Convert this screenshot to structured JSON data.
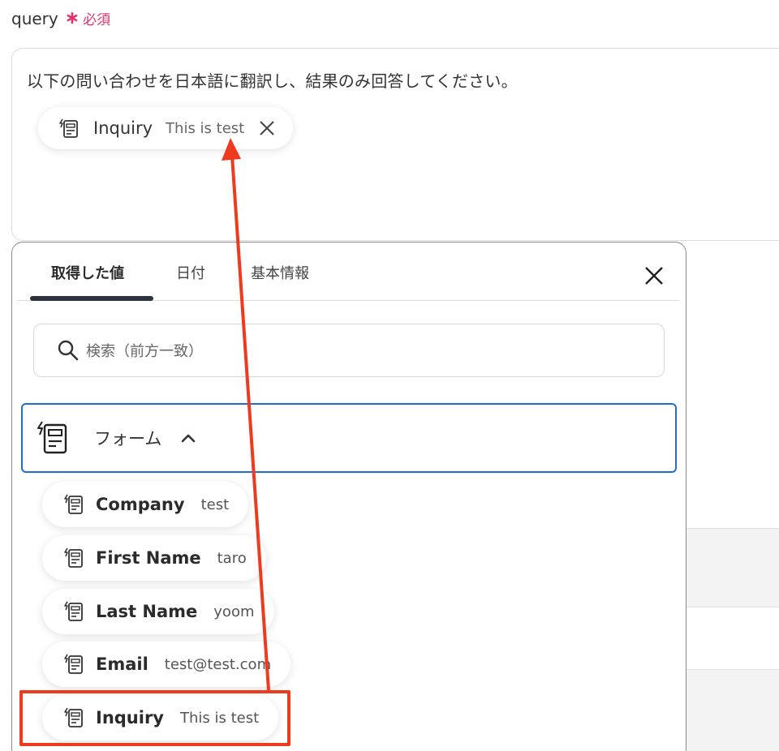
{
  "field": {
    "label": "query",
    "required_star": "∗",
    "required_text": "必須"
  },
  "query": {
    "text": "以下の問い合わせを日本語に翻訳し、結果のみ回答してください。",
    "chip": {
      "name": "Inquiry",
      "value": "This is test",
      "icon": "form-icon"
    }
  },
  "panel": {
    "tabs": [
      {
        "label": "取得した値",
        "active": true
      },
      {
        "label": "日付",
        "active": false
      },
      {
        "label": "基本情報",
        "active": false
      }
    ],
    "search_placeholder": "検索（前方一致）",
    "group": {
      "label": "フォーム",
      "icon": "form-icon",
      "expanded": true
    },
    "items": [
      {
        "name": "Company",
        "value": "test"
      },
      {
        "name": "First Name",
        "value": "taro"
      },
      {
        "name": "Last Name",
        "value": "yoom"
      },
      {
        "name": "Email",
        "value": "test@test.com"
      },
      {
        "name": "Inquiry",
        "value": "This is test",
        "highlighted": true
      }
    ]
  },
  "colors": {
    "required": "#e5326a",
    "group_border": "#1e6fc8",
    "annotation": "#ee3a1f"
  }
}
